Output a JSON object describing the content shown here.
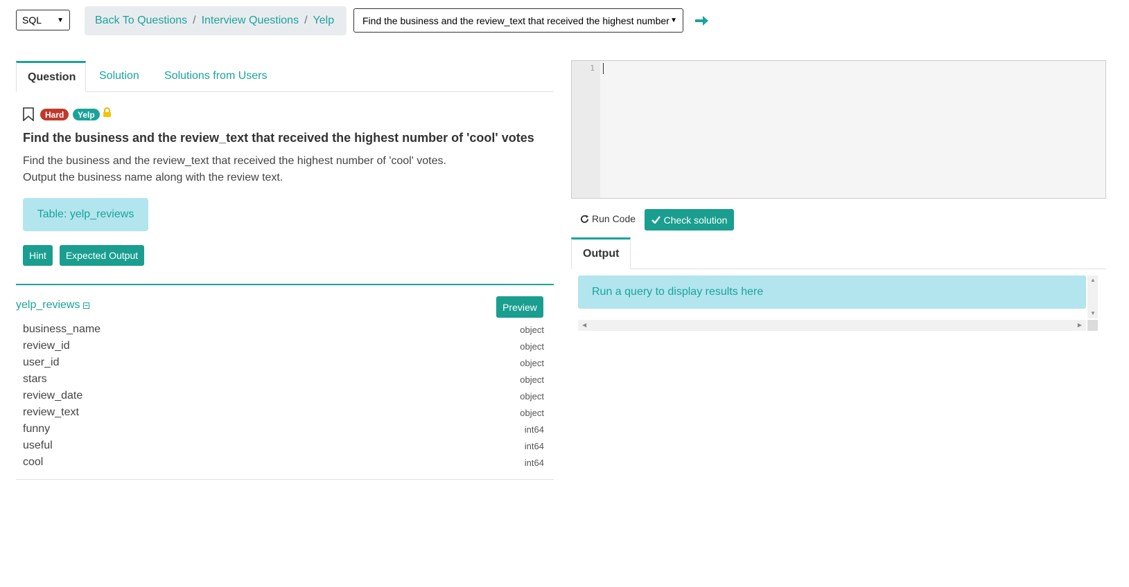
{
  "top_bar": {
    "language_select": "SQL",
    "breadcrumb": [
      "Back To Questions",
      "Interview Questions",
      "Yelp"
    ],
    "question_select": "Find the business and the review_text that received the highest number of 'cool' votes"
  },
  "tabs": [
    "Question",
    "Solution",
    "Solutions from Users"
  ],
  "question": {
    "difficulty": "Hard",
    "company": "Yelp",
    "title": "Find the business and the review_text that received the highest number of 'cool' votes",
    "description_line1": "Find the business and the review_text that received the highest number of  'cool' votes.",
    "description_line2": "Output the business name along with the review text.",
    "table_label": "Table: yelp_reviews",
    "hint_label": "Hint",
    "expected_output_label": "Expected Output"
  },
  "schema": {
    "table_name": "yelp_reviews",
    "preview_label": "Preview",
    "columns": [
      {
        "name": "business_name",
        "type": "object"
      },
      {
        "name": "review_id",
        "type": "object"
      },
      {
        "name": "user_id",
        "type": "object"
      },
      {
        "name": "stars",
        "type": "object"
      },
      {
        "name": "review_date",
        "type": "object"
      },
      {
        "name": "review_text",
        "type": "object"
      },
      {
        "name": "funny",
        "type": "int64"
      },
      {
        "name": "useful",
        "type": "int64"
      },
      {
        "name": "cool",
        "type": "int64"
      }
    ]
  },
  "editor": {
    "line_number": "1",
    "run_code_label": "Run Code",
    "check_solution_label": "Check solution"
  },
  "output": {
    "tab_label": "Output",
    "placeholder": "Run a query to display results here"
  },
  "colors": {
    "accent": "#1aa39a",
    "hard_badge": "#c0392b",
    "info_box": "#b3e5ee"
  }
}
